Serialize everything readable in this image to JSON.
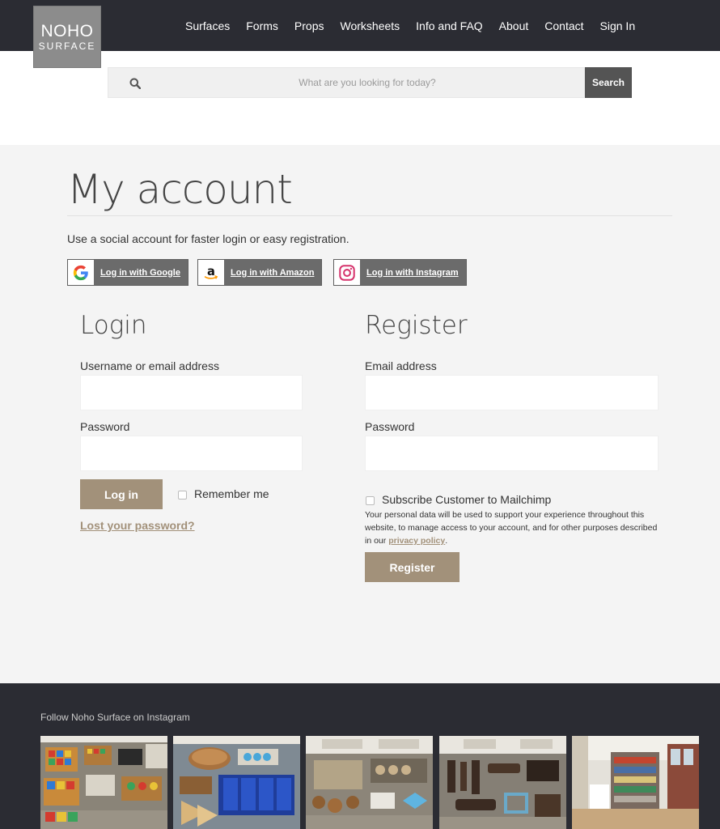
{
  "header": {
    "logo_line1": "NOHO",
    "logo_line2": "SURFACE",
    "nav": [
      "Surfaces",
      "Forms",
      "Props",
      "Worksheets",
      "Info and FAQ",
      "About",
      "Contact",
      "Sign In"
    ]
  },
  "search": {
    "placeholder": "What are you looking for today?",
    "button_label": "Search"
  },
  "page": {
    "title": "My account",
    "social_intro": "Use a social account for faster login or easy registration.",
    "social": {
      "google": "Log in with Google",
      "amazon": "Log in with Amazon",
      "instagram": "Log in with Instagram"
    }
  },
  "login": {
    "title": "Login",
    "username_label": "Username or email address",
    "password_label": "Password",
    "button": "Log in",
    "remember": "Remember me",
    "lost_password": "Lost your password?"
  },
  "register": {
    "title": "Register",
    "email_label": "Email address",
    "password_label": "Password",
    "subscribe": "Subscribe Customer to Mailchimp",
    "privacy_text": "Your personal data will be used to support your experience throughout this website, to manage access to your account, and for other purposes described in our",
    "privacy_link": "privacy policy",
    "privacy_end": ".",
    "button": "Register"
  },
  "footer": {
    "instagram_title": "Follow Noho Surface on Instagram"
  },
  "colors": {
    "header_bg": "#2b2c33",
    "accent": "#a2917a",
    "search_button": "#545454",
    "social_button": "#6b6b6b"
  }
}
